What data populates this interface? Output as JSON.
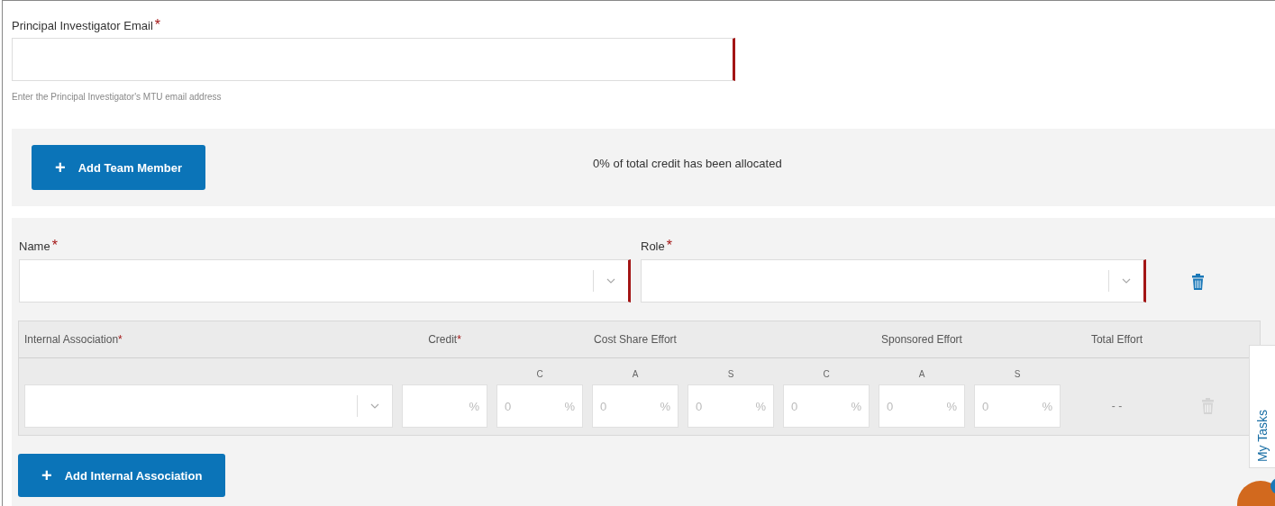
{
  "email": {
    "label": "Principal Investigator Email",
    "required_mark": "*",
    "invalid": true,
    "hint": "Enter the Principal Investigator's MTU email address"
  },
  "team_panel": {
    "add_button": {
      "icon": "+",
      "label": "Add Team Member"
    },
    "status": "0% of total credit has been allocated"
  },
  "member": {
    "name_field": {
      "label": "Name",
      "required_mark": "*",
      "invalid": true
    },
    "role_field": {
      "label": "Role",
      "required_mark": "*",
      "invalid": true
    },
    "delete_disabled": false,
    "associations": {
      "columns": [
        {
          "label": "Internal Association",
          "required_mark": "*",
          "kind": "single"
        },
        {
          "label": "Credit",
          "required_mark": "*",
          "kind": "single"
        },
        {
          "label": "Cost Share Effort",
          "kind": "group"
        },
        {
          "label": "Sponsored Effort",
          "kind": "group"
        },
        {
          "label": "Total Effort",
          "kind": "single"
        }
      ],
      "subcolumns": [
        "C",
        "A",
        "S",
        "C",
        "A",
        "S"
      ],
      "rows": [
        {
          "credit": {
            "unit": "%"
          },
          "efforts": [
            {
              "placeholder": "0",
              "unit": "%"
            },
            {
              "placeholder": "0",
              "unit": "%"
            },
            {
              "placeholder": "0",
              "unit": "%"
            },
            {
              "placeholder": "0",
              "unit": "%"
            },
            {
              "placeholder": "0",
              "unit": "%"
            },
            {
              "placeholder": "0",
              "unit": "%"
            }
          ],
          "total": "- -",
          "delete_disabled": true
        }
      ]
    },
    "add_association_button": {
      "icon": "+",
      "label": "Add Internal Association"
    }
  },
  "side_tab": {
    "label": "My Tasks"
  }
}
